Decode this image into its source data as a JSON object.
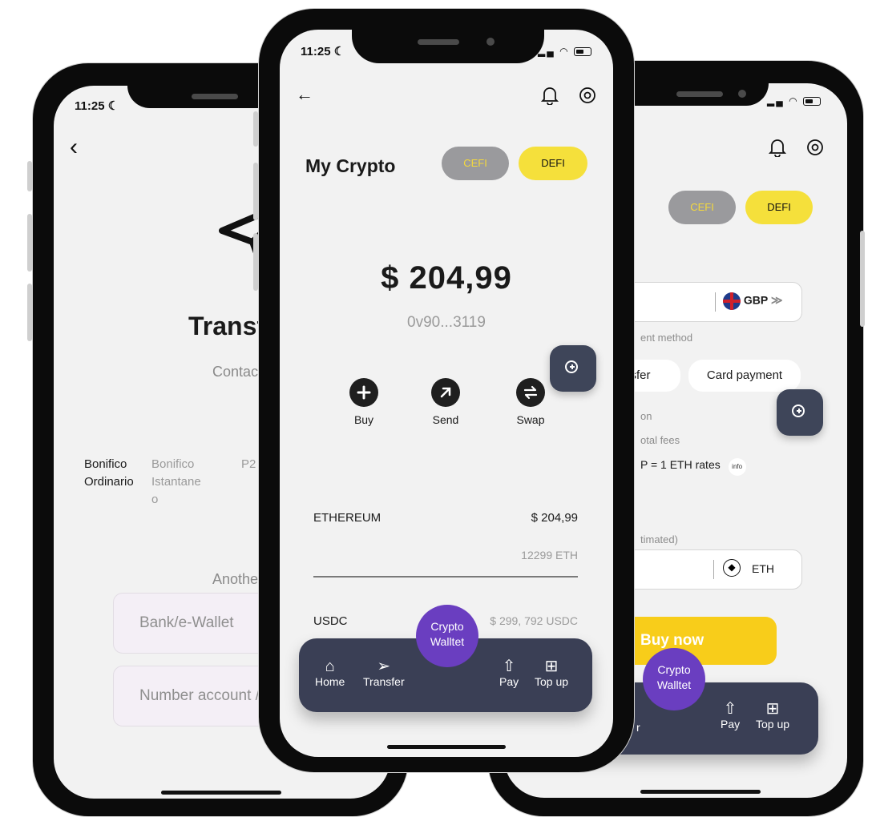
{
  "left": {
    "time": "11:25",
    "title": "Transfe",
    "contact": "Contact",
    "methods": [
      {
        "line1": "Bonifico",
        "line2": "Ordinario",
        "line3": ""
      },
      {
        "line1": "Bonifico",
        "line2": "Istantane",
        "line3": "o"
      },
      {
        "line1": "P2",
        "line2": "",
        "line3": ""
      }
    ],
    "another": "Another",
    "input1_placeholder": "Bank/e-Wallet",
    "input2_placeholder": "Number account / I"
  },
  "center": {
    "time": "11:25",
    "title": "My Crypto",
    "cefi": "CEFI",
    "defi": "DEFI",
    "balance": "$ 204,99",
    "address": "0v90...3119",
    "actions": [
      "Buy",
      "Send",
      "Swap"
    ],
    "assets": [
      {
        "name": "ETHEREUM",
        "value": "$ 204,99",
        "sub": "12299 ETH"
      },
      {
        "name": "USDC",
        "value": "$ 299, 792 USDC",
        "sub": ""
      }
    ],
    "wallet_line1": "Crypto",
    "wallet_line2": "Walltet",
    "nav": [
      "Home",
      "Transfer",
      "Pay",
      "Top up"
    ]
  },
  "right": {
    "cefi": "CEFI",
    "defi": "DEFI",
    "currency": "GBP",
    "payment_method_label": "ent method",
    "chip_transfer": "sfer",
    "chip_card": "Card payment",
    "label_on": "on",
    "label_total_fees": "otal fees",
    "rate_text": "P = 1 ETH rates",
    "info": "info",
    "estimated": "timated)",
    "crypto": "ETH",
    "buy_now": "Buy now",
    "wallet_line1": "Crypto",
    "wallet_line2": "Walltet",
    "nav_partial": "r",
    "nav": [
      "Pay",
      "Top up"
    ]
  },
  "colors": {
    "accent_yellow": "#f5e03b",
    "navbar": "#3a3f55",
    "wallet_purple": "#6a3ec0",
    "buy_button": "#f8cd1a"
  }
}
